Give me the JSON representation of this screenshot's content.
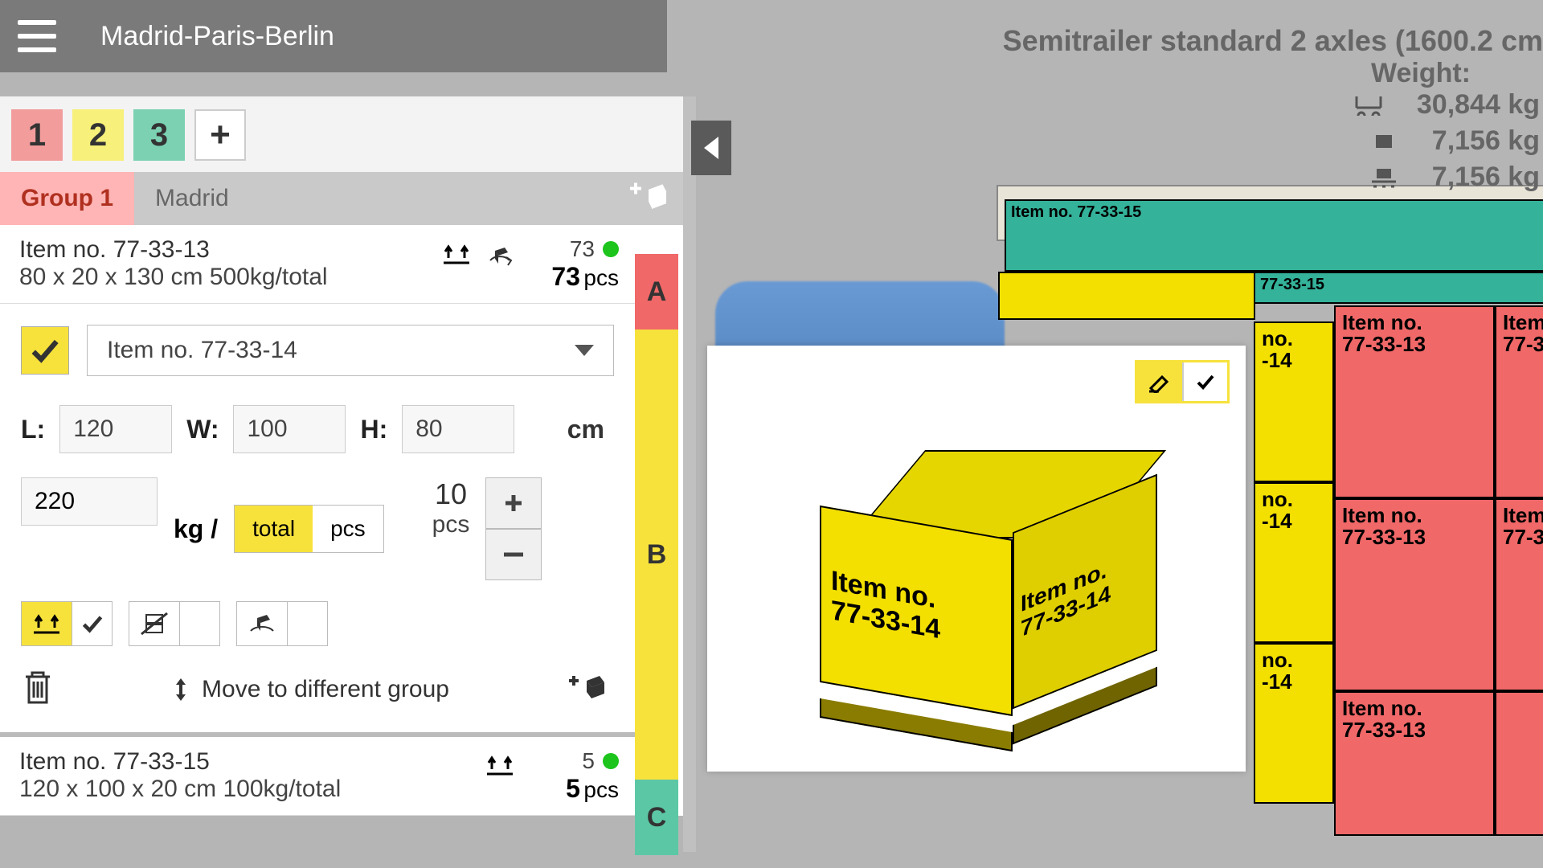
{
  "header": {
    "route": "Madrid-Paris-Berlin"
  },
  "stops": [
    {
      "label": "1"
    },
    {
      "label": "2"
    },
    {
      "label": "3"
    }
  ],
  "groups": {
    "active_tab": "Group 1",
    "inactive_tab": "Madrid"
  },
  "item_a": {
    "name": "Item no. 77-33-13",
    "dims": "80 x 20 x 130 cm 500kg/total",
    "count_top": "73",
    "count_big": "73",
    "pcs_suffix": "pcs"
  },
  "item_b": {
    "selected_name": "Item no. 77-33-14",
    "L_label": "L:",
    "L": "120",
    "W_label": "W:",
    "W": "100",
    "H_label": "H:",
    "H": "80",
    "unit": "cm",
    "weight": "220",
    "kg_slash": "kg /",
    "toggle_total": "total",
    "toggle_pcs": "pcs",
    "pcs_num": "10",
    "pcs_label": "pcs",
    "move_text": "Move to different group"
  },
  "item_c": {
    "name": "Item no. 77-33-15",
    "dims": "120 x 100 x 20 cm 100kg/total",
    "count_top": "5",
    "count_big": "5",
    "pcs_suffix": "pcs"
  },
  "letters": {
    "a": "A",
    "b": "B",
    "c": "C"
  },
  "vehicle": {
    "title": "Semitrailer standard 2 axles (1600.2 cm",
    "weight_label": "Weight:",
    "w1": "30,844 kg",
    "w2": "7,156 kg",
    "w3": "7,156 kg"
  },
  "popup_box": {
    "line1": "Item no.",
    "line2": "77-33-14"
  },
  "scene_labels": {
    "red1a": "Item no.",
    "red1b": "77-33-13",
    "red2a": "Item",
    "red2b": "77-3",
    "yel1": "no.",
    "yel2": "-14",
    "teal_a": "Item no. 77-33-15",
    "teal_b": "77-33-15"
  }
}
